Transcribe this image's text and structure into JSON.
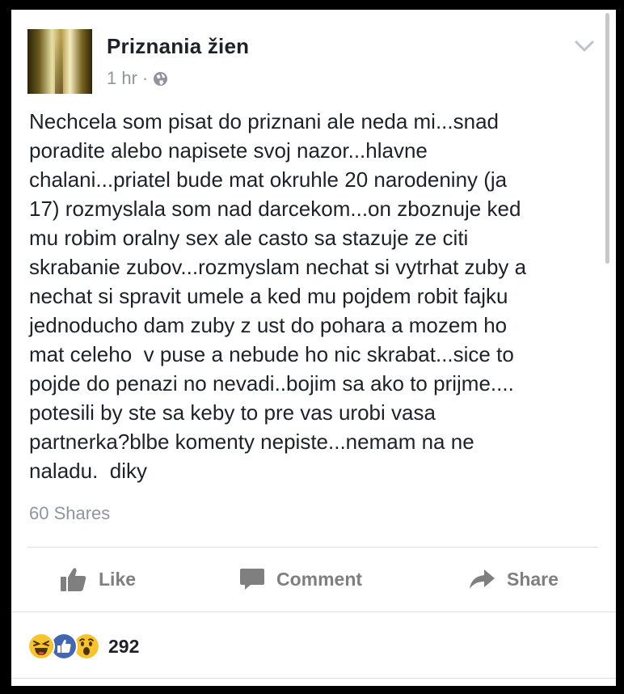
{
  "post": {
    "page_name": "Priznania žien",
    "time": "1 hr",
    "separator": "·",
    "privacy_icon": "globe-icon",
    "menu_icon": "chevron-down-icon",
    "text": "Nechcela som pisat do priznani ale neda mi...snad\nporadite alebo napisete svoj nazor...hlavne\nchalani...priatel bude mat okruhle 20 narodeniny (ja\n17) rozmyslala som nad darcekom...on zboznuje ked\nmu robim oralny sex ale casto sa stazuje ze citi\nskrabanie zubov...rozmyslam nechat si vytrhat zuby a\nnechat si spravit umele a ked mu pojdem robit fajku\njednoducho dam zuby z ust do pohara a mozem ho\nmat celeho  v puse a nebude ho nic skrabat...sice to\npojde do penazi no nevadi..bojim sa ako to prijme....\npotesili by ste sa keby to pre vas urobi vasa\npartnerka?blbe komenty nepiste...nemam na ne\nnaladu.  diky",
    "shares": "60 Shares"
  },
  "actions": {
    "like": {
      "label": "Like",
      "icon": "thumbs-up-icon"
    },
    "comment": {
      "label": "Comment",
      "icon": "comment-icon"
    },
    "share": {
      "label": "Share",
      "icon": "share-arrow-icon"
    }
  },
  "reactions": {
    "icons": [
      "haha-reaction-icon",
      "like-reaction-icon",
      "wow-reaction-icon"
    ],
    "count": "292"
  },
  "colors": {
    "text": "#1d2129",
    "muted": "#90949c",
    "action": "#7f7f7f",
    "like_blue": "#4267b2",
    "reaction_yellow": "#f7c42d"
  }
}
